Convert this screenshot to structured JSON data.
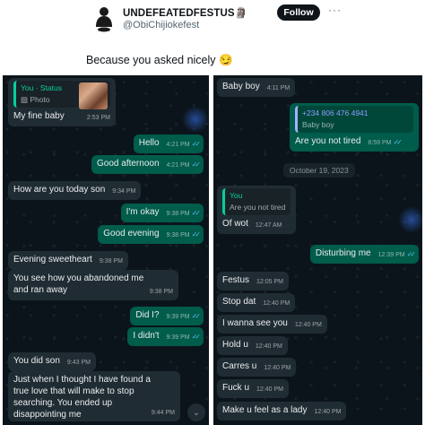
{
  "tweet": {
    "author_name": "UNDEFEATEDFESTUS🗿",
    "author_handle": "@ObiChijiokefest",
    "follow_label": "Follow",
    "more_label": "···",
    "text": "Because you asked nicely 😏"
  },
  "left_chat": {
    "reply_quote": {
      "name": "You · Status",
      "text": "▨ Photo"
    },
    "messages": [
      {
        "text": "My fine baby",
        "time": "2:53 PM"
      },
      {
        "text": "Hello",
        "time": "4:21 PM",
        "ticks": "✓✓"
      },
      {
        "text": "Good afternoon",
        "time": "4:21 PM",
        "ticks": "✓✓"
      },
      {
        "text": "How are you today son",
        "time": "9:34 PM"
      },
      {
        "text": "I'm okay",
        "time": "9:38 PM",
        "ticks": "✓✓"
      },
      {
        "text": "Good evening",
        "time": "9:38 PM",
        "ticks": "✓✓"
      },
      {
        "text": "Evening sweetheart",
        "time": "9:38 PM"
      },
      {
        "text": "You see how you abandoned me and ran away",
        "time": "9:38 PM"
      },
      {
        "text": "Did I?",
        "time": "9:39 PM",
        "ticks": "✓✓"
      },
      {
        "text": "I didn't",
        "time": "9:39 PM",
        "ticks": "✓✓"
      },
      {
        "text": "You did son",
        "time": "9:43 PM"
      },
      {
        "text": "Just when I thought I have found a true love that will make to stop searching. You ended up disappointing me",
        "time": "9:44 PM"
      }
    ],
    "scroll_icon": "chevron-down-icon"
  },
  "right_chat": {
    "messages": [
      {
        "text": "Baby boy",
        "time": "4:11 PM"
      },
      {
        "quote_name": "+234 806 476 4941",
        "quote_text": "Baby boy",
        "text": "Are you not tired",
        "time": "8:59 PM",
        "ticks": "✓✓"
      },
      {
        "quote_name": "You",
        "quote_text": "Are you not tired",
        "text": "Of wot",
        "time": "12:47 AM"
      },
      {
        "text": "Disturbing me",
        "time": "12:39 PM",
        "ticks": "✓✓"
      },
      {
        "text": "Festus",
        "time": "12:05 PM"
      },
      {
        "text": "Stop dat",
        "time": "12:40 PM"
      },
      {
        "text": "I wanna see you",
        "time": "12:40 PM"
      },
      {
        "text": "Hold u",
        "time": "12:40 PM"
      },
      {
        "text": "Carres u",
        "time": "12:40 PM"
      },
      {
        "text": "Fuck u",
        "time": "12:40 PM"
      },
      {
        "text": "Make u feel as a lady",
        "time": "12:40 PM"
      }
    ],
    "date_divider": "October 19, 2023"
  },
  "colors": {
    "chat_background": "#0b141a",
    "incoming_bubble": "#202c33",
    "outgoing_bubble": "#005c4b",
    "read_ticks": "#53bdeb",
    "quote_accent": "#06cf9c"
  }
}
